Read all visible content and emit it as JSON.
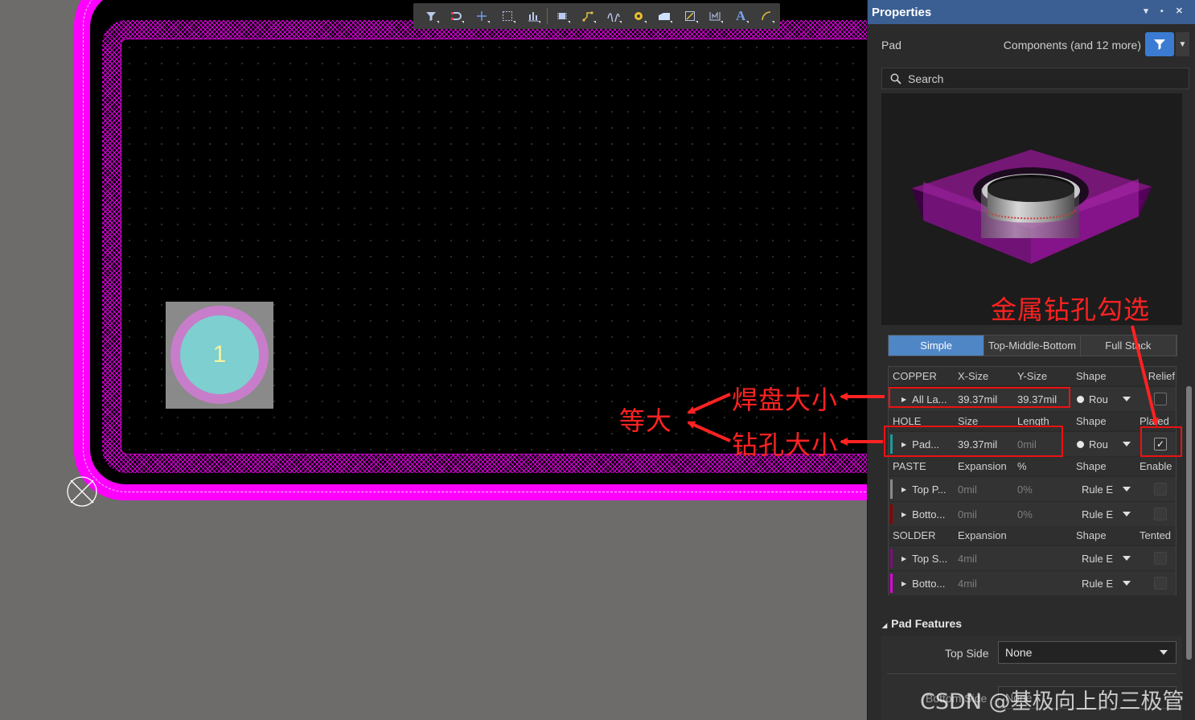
{
  "toolbar": {
    "icons": [
      "filter-icon",
      "snap-icon",
      "cross-icon",
      "select-rect-icon",
      "align-icon",
      "component-icon",
      "route-icon",
      "interactive-route-icon",
      "via-icon",
      "fill-icon",
      "polygon-icon",
      "dimension-icon",
      "text-icon",
      "arc-icon"
    ]
  },
  "pad": {
    "number": "1"
  },
  "annotations": {
    "plated": "金属钻孔勾选",
    "pad_size": "焊盘大小",
    "equal": "等大",
    "hole_size": "钻孔大小"
  },
  "panel": {
    "title": "Properties",
    "object_type": "Pad",
    "selection_scope": "Components (and 12 more)",
    "search_placeholder": "Search",
    "tabs": [
      "Simple",
      "Top-Middle-Bottom",
      "Full Stack"
    ],
    "copper": {
      "headers": [
        "COPPER",
        "X-Size",
        "Y-Size",
        "Shape",
        "Relief"
      ],
      "row": {
        "name": "All La...",
        "x_size": "39.37mil",
        "y_size": "39.37mil",
        "shape": "Rou",
        "relief": false
      }
    },
    "hole": {
      "headers": [
        "HOLE",
        "Size",
        "Length",
        "Shape",
        "Plated"
      ],
      "row": {
        "name": "Pad...",
        "size": "39.37mil",
        "length": "0mil",
        "shape": "Rou",
        "plated": true
      }
    },
    "paste": {
      "headers": [
        "PASTE",
        "Expansion",
        "%",
        "Shape",
        "Enable"
      ],
      "rows": [
        {
          "name": "Top P...",
          "expansion": "0mil",
          "percent": "0%",
          "shape": "Rule E",
          "color": "#8a8a8a"
        },
        {
          "name": "Botto...",
          "expansion": "0mil",
          "percent": "0%",
          "shape": "Rule E",
          "color": "#8b0000"
        }
      ]
    },
    "solder": {
      "headers": [
        "SOLDER",
        "Expansion",
        "Shape",
        "Tented"
      ],
      "rows": [
        {
          "name": "Top S...",
          "expansion": "4mil",
          "shape": "Rule E",
          "color": "#7a0f7a"
        },
        {
          "name": "Botto...",
          "expansion": "4mil",
          "shape": "Rule E",
          "color": "#e000e0"
        }
      ]
    },
    "pad_features": {
      "title": "Pad Features",
      "top_side_label": "Top Side",
      "top_side_value": "None",
      "bottom_side_label": "Bottom Side",
      "bottom_side_value": "None"
    }
  },
  "watermark": "CSDN @基极向上的三极管",
  "colors": {
    "board": "#ff00ff",
    "pad_ring": "#c77dc9",
    "pad_core": "#7ecfcf",
    "accent": "#3b7bd1",
    "annotation": "#ff2222"
  }
}
